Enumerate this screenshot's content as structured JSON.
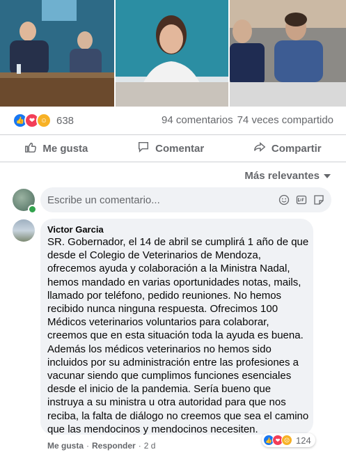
{
  "post": {
    "reaction_count": "638",
    "comments_text": "94 comentarios",
    "shares_text": "74 veces compartido",
    "reactions": [
      "like",
      "love",
      "care"
    ]
  },
  "actions": {
    "like": "Me gusta",
    "comment": "Comentar",
    "share": "Compartir"
  },
  "sort": {
    "label": "Más relevantes"
  },
  "composer": {
    "placeholder": "Escribe un comentario..."
  },
  "comment": {
    "author": "Victor Garcia",
    "text": "SR. Gobernador, el 14 de abril se cumplirá 1 año de que desde el Colegio de Veterinarios de Mendoza, ofrecemos ayuda y colaboración a la Ministra Nadal, hemos mandado en varias oportunidades notas, mails, llamado por teléfono, pedido reuniones. No hemos recibido nunca ninguna respuesta. Ofrecimos 100 Médicos veterinarios voluntarios para colaborar, creemos que en esta situación toda la ayuda es buena. Además los médicos veterinarios no hemos sido incluidos por su administración entre las profesiones a vacunar siendo que cumplimos funciones esenciales desde el inicio de la pandemia. Sería bueno que instruya a su ministra u otra autoridad para que nos reciba, la falta de diálogo no creemos que sea el camino que las mendocinos y mendocinos necesiten.",
    "like_label": "Me gusta",
    "reply_label": "Responder",
    "separator": "·",
    "age": "2 d",
    "reaction_count": "124"
  },
  "colors": {
    "like": "#1877f2",
    "love": "#f33e58",
    "care": "#f7b125",
    "secondary_text": "#65676b",
    "bubble": "#f0f2f5"
  }
}
